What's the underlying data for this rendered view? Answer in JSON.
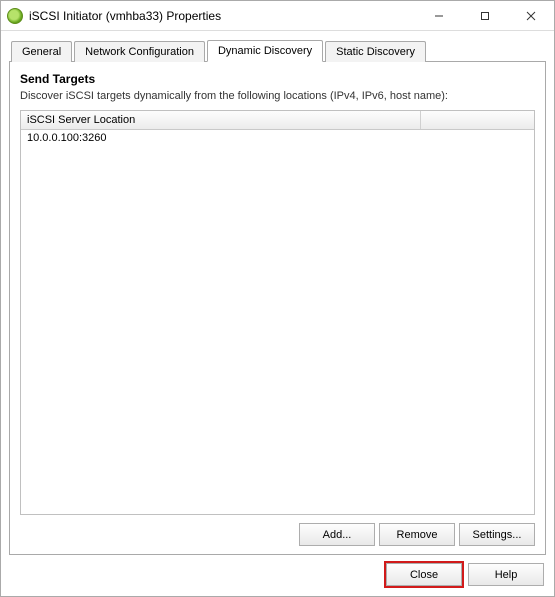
{
  "window": {
    "title": "iSCSI Initiator (vmhba33) Properties"
  },
  "tabs": {
    "general": "General",
    "network": "Network Configuration",
    "dynamic": "Dynamic Discovery",
    "static": "Static Discovery",
    "active": "dynamic"
  },
  "dynamic_panel": {
    "section_title": "Send Targets",
    "description": "Discover iSCSI targets dynamically from the following locations (IPv4, IPv6, host name):",
    "column_header": "iSCSI Server Location",
    "rows": [
      {
        "location": "10.0.0.100:3260"
      }
    ],
    "buttons": {
      "add": "Add...",
      "remove": "Remove",
      "settings": "Settings..."
    }
  },
  "dialog_buttons": {
    "close": "Close",
    "help": "Help"
  }
}
